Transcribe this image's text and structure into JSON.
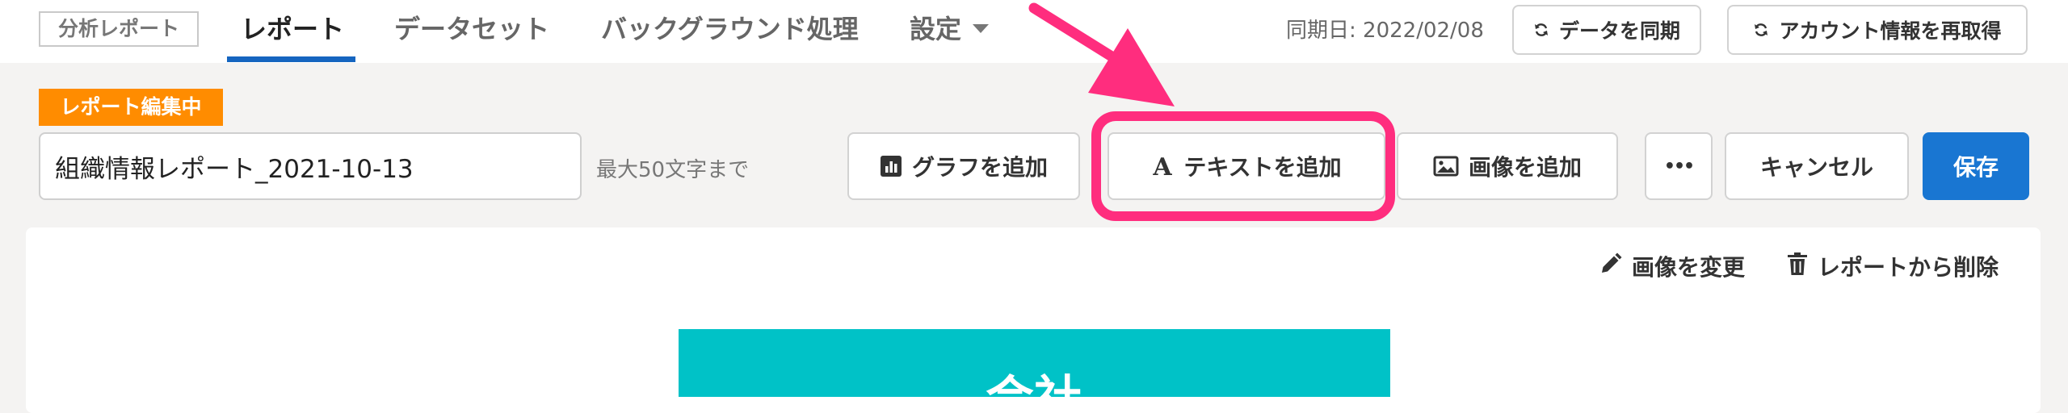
{
  "header": {
    "app_tag": "分析レポート",
    "tabs": [
      {
        "label": "レポート",
        "active": true
      },
      {
        "label": "データセット"
      },
      {
        "label": "バックグラウンド処理"
      },
      {
        "label": "設定"
      }
    ],
    "sync_date": "同期日: 2022/02/08",
    "sync_button": "データを同期",
    "reacquire_button": "アカウント情報を再取得"
  },
  "toolbar": {
    "editing_badge": "レポート編集中",
    "report_name_value": "組織情報レポート_2021-10-13",
    "max_chars_hint": "最大50文字まで",
    "add_graph": "グラフを追加",
    "add_text": "テキストを追加",
    "add_image": "画像を追加",
    "more": "•••",
    "cancel": "キャンセル",
    "save": "保存"
  },
  "canvas": {
    "change_image": "画像を変更",
    "remove_from_report": "レポートから削除",
    "block_text": "会社"
  },
  "colors": {
    "accent": "#1565c0",
    "save": "#1976d2",
    "badge": "#ff8c00",
    "highlight": "#ff2d7e",
    "teal": "#00c2c7"
  }
}
